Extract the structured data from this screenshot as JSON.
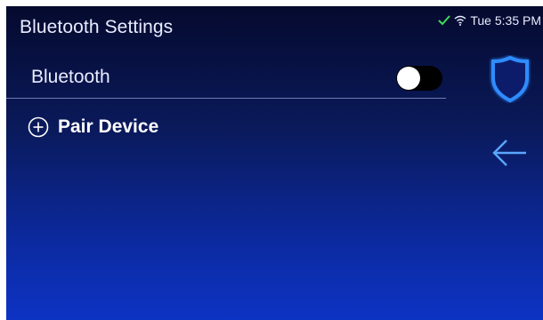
{
  "header": {
    "title": "Bluetooth Settings"
  },
  "status_bar": {
    "time": "Tue 5:35 PM",
    "icons": [
      "checkmark-icon",
      "wifi-icon"
    ],
    "check_color": "#3ddc5a"
  },
  "settings": {
    "bluetooth_label": "Bluetooth",
    "bluetooth_enabled": false,
    "pair_label": "Pair Device"
  },
  "side_rail": {
    "icons": [
      "shield-icon",
      "back-arrow-icon"
    ],
    "accent_color": "#2f8cff"
  }
}
